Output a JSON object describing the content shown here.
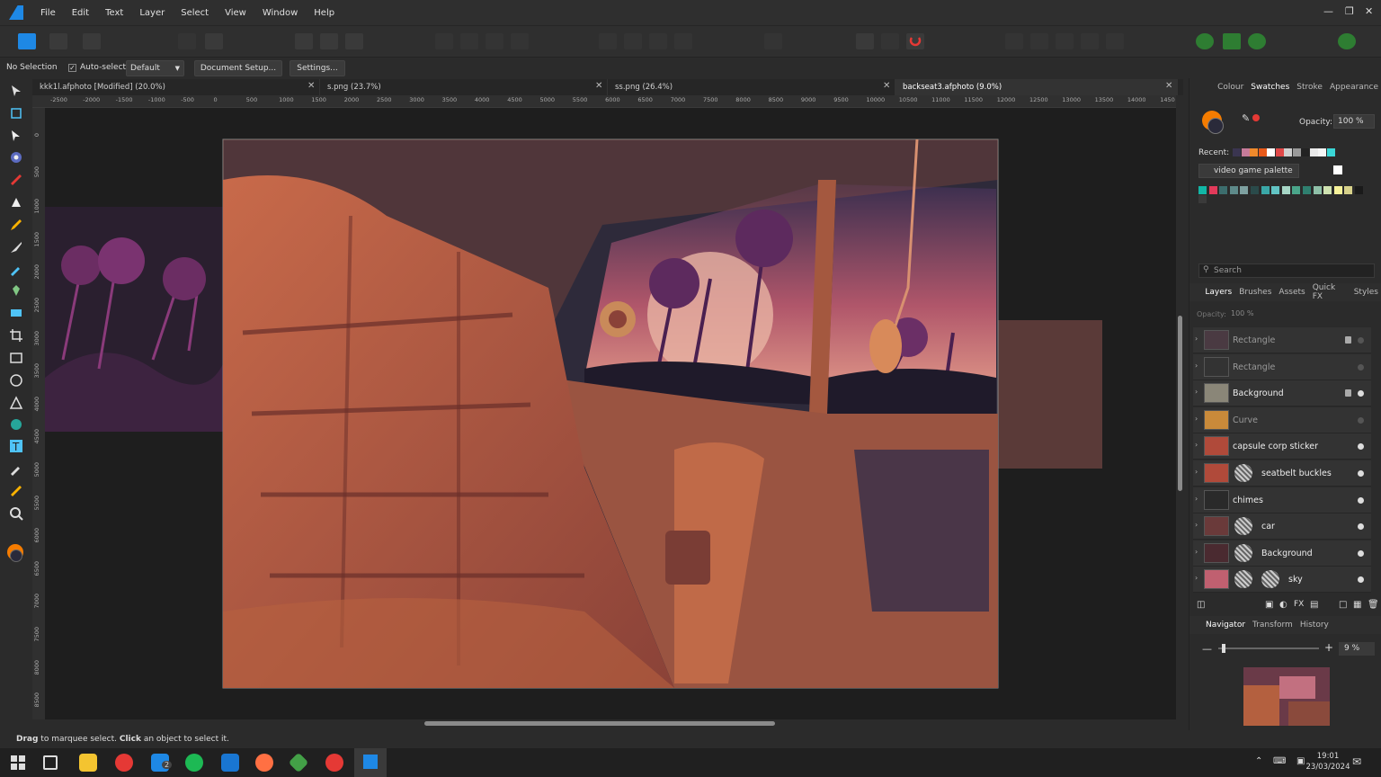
{
  "app": {
    "menu": [
      "File",
      "Edit",
      "Text",
      "Layer",
      "Select",
      "View",
      "Window",
      "Help"
    ],
    "accent": "#1e88e5"
  },
  "context_bar": {
    "selection": "No Selection",
    "auto_select_label": "Auto-select:",
    "auto_select_value": "Default",
    "document_setup": "Document Setup...",
    "settings": "Settings..."
  },
  "tabs": [
    {
      "label": "kkk1l.afphoto [Modified] (20.0%)"
    },
    {
      "label": "s.png (23.7%)"
    },
    {
      "label": "ss.png (26.4%)"
    },
    {
      "label": "backseat3.afphoto (9.0%)"
    }
  ],
  "ruler_top": [
    "-2500",
    "-2000",
    "-1500",
    "-1000",
    "-500",
    "0",
    "500",
    "1000",
    "1500",
    "2000",
    "2500",
    "3000",
    "3500",
    "4000",
    "4500",
    "5000",
    "5500",
    "6000",
    "6500",
    "7000",
    "7500",
    "8000",
    "8500",
    "9000",
    "9500",
    "10000",
    "10500",
    "11000",
    "11500",
    "12000",
    "12500",
    "13000",
    "13500",
    "14000",
    "1450"
  ],
  "ruler_left": [
    "0",
    "500",
    "1000",
    "1500",
    "2000",
    "2500",
    "3000",
    "3500",
    "4000",
    "4500",
    "5000",
    "5500",
    "6000",
    "6500",
    "7000",
    "7500",
    "8000",
    "8500"
  ],
  "status": {
    "bold1": "Drag",
    "text1": " to marquee select. ",
    "bold2": "Click",
    "text2": " an object to select it."
  },
  "colour_panel": {
    "tabs": [
      "Colour",
      "Swatches",
      "Stroke",
      "Appearance"
    ],
    "active_tab": "Swatches",
    "opacity_label": "Opacity:",
    "opacity_value": "100 %",
    "recent_label": "Recent:",
    "palette_name": "video game palette",
    "recent_colors": [
      "#3a3550",
      "#c77b9a",
      "#f08a2c",
      "#e85a1a",
      "#ffffff",
      "#e04848",
      "#cfcfcf",
      "#9a9a9a",
      "#222222",
      "#eaeaea",
      "#f5f5f5",
      "#3ad7d7"
    ],
    "palette_colors": [
      "#12b6a6",
      "#e23a5a",
      "#3c6d6d",
      "#5e8a8a",
      "#7ea0a0",
      "#2a4a4a",
      "#3aa7a7",
      "#62c4c4",
      "#a6d6c6",
      "#4aa58a",
      "#2f7f6f",
      "#8fc0a8",
      "#cfe2b0",
      "#f6f29a",
      "#d7d18a",
      "#1a1a1a",
      "#3a3a3a"
    ],
    "search_placeholder": "Search"
  },
  "layers_panel": {
    "tabs": [
      "Layers",
      "Brushes",
      "Assets",
      "Quick FX",
      "Styles"
    ],
    "active_tab": "Layers",
    "opacity_label": "Opacity:",
    "opacity_value": "100 %",
    "layers": [
      {
        "name": "Rectangle",
        "dim": true,
        "locked": true
      },
      {
        "name": "Rectangle",
        "dim": true,
        "locked": false
      },
      {
        "name": "Background",
        "dim": false,
        "locked": true
      },
      {
        "name": "Curve",
        "dim": true,
        "locked": false
      },
      {
        "name": "capsule corp sticker",
        "dim": false,
        "locked": false
      },
      {
        "name": "seatbelt buckles",
        "dim": false,
        "locked": false
      },
      {
        "name": "chimes",
        "dim": false,
        "locked": false
      },
      {
        "name": "car",
        "dim": false,
        "locked": false
      },
      {
        "name": "Background",
        "dim": false,
        "locked": false
      },
      {
        "name": "sky",
        "dim": false,
        "locked": false
      }
    ]
  },
  "navigator_panel": {
    "tabs": [
      "Navigator",
      "Transform",
      "History"
    ],
    "active_tab": "Navigator",
    "zoom": "9 %"
  },
  "taskbar": {
    "time": "19:01",
    "date": "23/03/2024",
    "badge": "2"
  }
}
